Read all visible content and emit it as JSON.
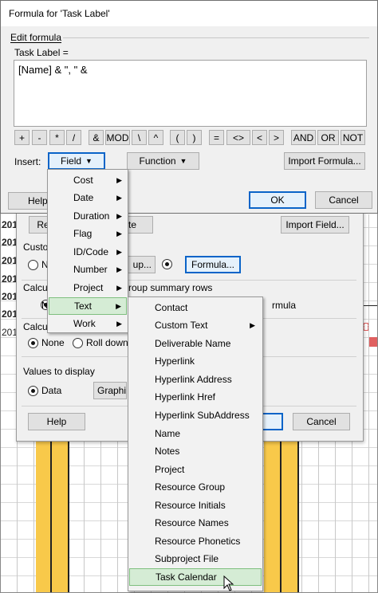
{
  "dialog": {
    "title": "Formula for 'Task Label'",
    "edit_formula_label": "Edit formula",
    "field_label": "Task Label =",
    "formula_text": "[Name] & \", \" &",
    "operators": [
      "+",
      "-",
      "*",
      "/",
      "&",
      "MOD",
      "\\",
      "^",
      "(",
      ")",
      "=",
      "<>",
      "<",
      ">",
      "AND",
      "OR",
      "NOT"
    ],
    "insert_label": "Insert:",
    "field_button": "Field",
    "function_button": "Function",
    "import_formula_button": "Import Formula...",
    "help_button": "Help",
    "ok_button": "OK",
    "cancel_button": "Cancel"
  },
  "field_menu": {
    "items": [
      {
        "label": "Cost",
        "submenu": true
      },
      {
        "label": "Date",
        "submenu": true
      },
      {
        "label": "Duration",
        "submenu": true
      },
      {
        "label": "Flag",
        "submenu": true
      },
      {
        "label": "ID/Code",
        "submenu": true
      },
      {
        "label": "Number",
        "submenu": true
      },
      {
        "label": "Project",
        "submenu": true
      },
      {
        "label": "Text",
        "submenu": true,
        "highlighted": true
      },
      {
        "label": "Work",
        "submenu": true
      }
    ],
    "highlight_color": "#d5ecd5"
  },
  "text_submenu": {
    "items": [
      {
        "label": "Contact"
      },
      {
        "label": "Custom Text",
        "submenu": true
      },
      {
        "label": "Deliverable Name"
      },
      {
        "label": "Hyperlink"
      },
      {
        "label": "Hyperlink Address"
      },
      {
        "label": "Hyperlink Href"
      },
      {
        "label": "Hyperlink SubAddress"
      },
      {
        "label": "Name"
      },
      {
        "label": "Notes"
      },
      {
        "label": "Project"
      },
      {
        "label": "Resource Group"
      },
      {
        "label": "Resource Initials"
      },
      {
        "label": "Resource Names"
      },
      {
        "label": "Resource Phonetics"
      },
      {
        "label": "Subproject File"
      },
      {
        "label": "Task Calendar",
        "highlighted": true
      }
    ]
  },
  "back_dialog": {
    "rename_button": "Re",
    "te_fragment": "te",
    "import_field_button": "Import Field...",
    "custom_label": "Custo",
    "n_option": "N",
    "lookup_button": "up...",
    "formula_button": "Formula...",
    "calc_label_1": "Calcul",
    "group_summary_text": "roup summary rows",
    "rmula_fragment": "rmula",
    "calc_label_2": "Calcul",
    "none_option": "None",
    "rolldown_option": "Roll down",
    "values_to_display": "Values to display",
    "data_option": "Data",
    "graphic_button": "Graphi",
    "help_button": "Help",
    "cancel_button": "Cancel"
  },
  "background": {
    "row_labels": [
      "201",
      "201",
      "201",
      "201",
      "201",
      "201",
      "201"
    ],
    "task_bar_color": "#f8c94a"
  }
}
